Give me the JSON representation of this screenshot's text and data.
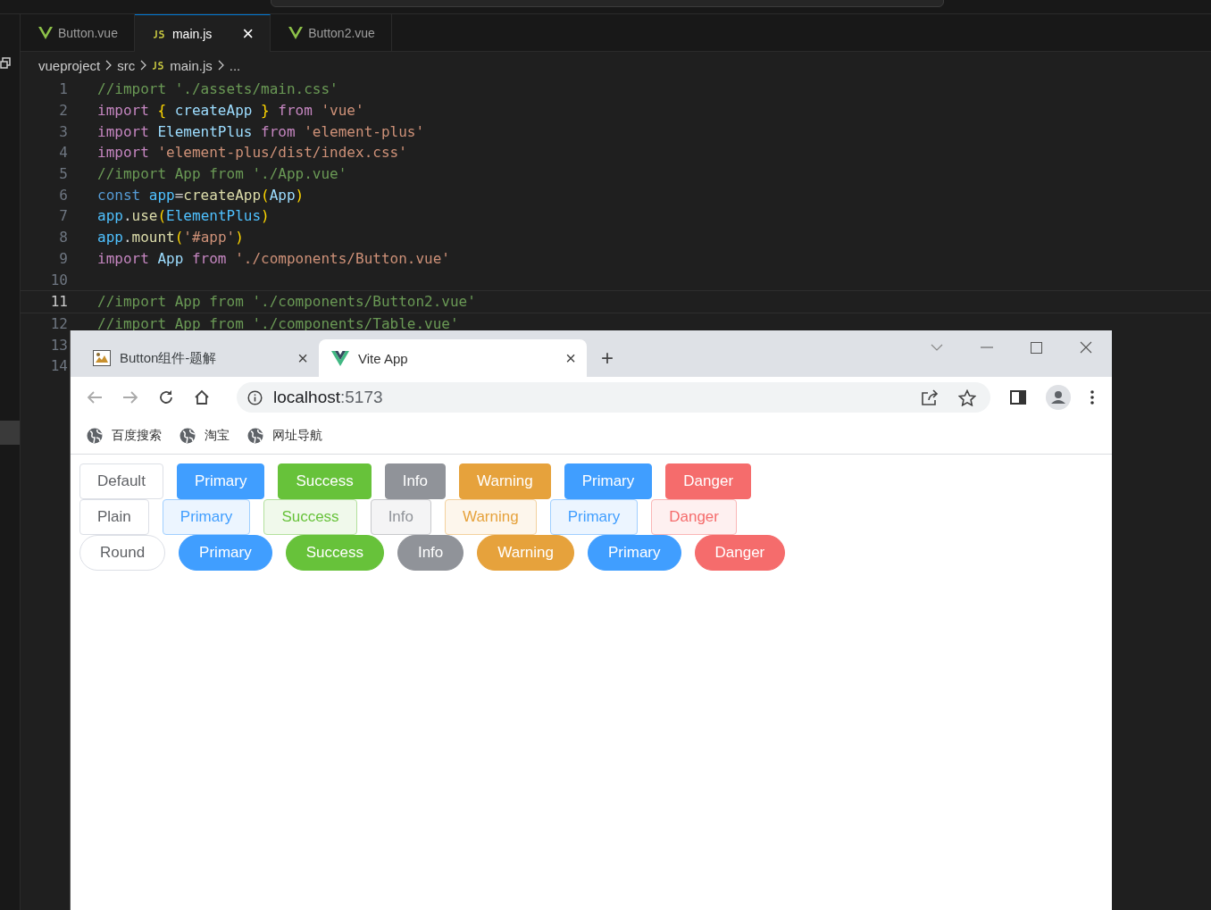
{
  "editor": {
    "tabs": [
      {
        "label": "Button.vue",
        "kind": "vue",
        "selected": false
      },
      {
        "label": "main.js",
        "kind": "js",
        "selected": true,
        "close": "×"
      },
      {
        "label": "Button2.vue",
        "kind": "vue",
        "selected": false
      }
    ],
    "breadcrumbs": [
      {
        "label": "vueproject",
        "kind": "folder"
      },
      {
        "label": "src",
        "kind": "folder"
      },
      {
        "label": "main.js",
        "kind": "js"
      },
      {
        "label": "...",
        "kind": "more"
      }
    ],
    "lines": [
      {
        "number": "1",
        "current": false,
        "tokens": [
          {
            "text": "//import './assets/main.css'",
            "kind": "comment"
          }
        ]
      },
      {
        "number": "2",
        "current": false,
        "tokens": [
          {
            "text": "import ",
            "kind": "keyword"
          },
          {
            "text": "{ ",
            "kind": "brace"
          },
          {
            "text": "createApp ",
            "kind": "variable"
          },
          {
            "text": "} ",
            "kind": "brace"
          },
          {
            "text": "from ",
            "kind": "keyword"
          },
          {
            "text": "'vue'",
            "kind": "string"
          }
        ]
      },
      {
        "number": "3",
        "current": false,
        "tokens": [
          {
            "text": "import ",
            "kind": "keyword"
          },
          {
            "text": "ElementPlus ",
            "kind": "variable"
          },
          {
            "text": "from ",
            "kind": "keyword"
          },
          {
            "text": "'element-plus'",
            "kind": "string"
          }
        ]
      },
      {
        "number": "4",
        "current": false,
        "tokens": [
          {
            "text": "import ",
            "kind": "keyword"
          },
          {
            "text": "'element-plus/dist/index.css'",
            "kind": "string"
          }
        ]
      },
      {
        "number": "5",
        "current": false,
        "tokens": [
          {
            "text": "//import App from './App.vue'",
            "kind": "comment"
          }
        ]
      },
      {
        "number": "6",
        "current": false,
        "tokens": [
          {
            "text": "const ",
            "kind": "storage"
          },
          {
            "text": "app",
            "kind": "constant"
          },
          {
            "text": "=",
            "kind": "plain"
          },
          {
            "text": "createApp",
            "kind": "function"
          },
          {
            "text": "(",
            "kind": "brace"
          },
          {
            "text": "App",
            "kind": "variable"
          },
          {
            "text": ")",
            "kind": "brace"
          }
        ]
      },
      {
        "number": "7",
        "current": false,
        "tokens": [
          {
            "text": "app",
            "kind": "constant"
          },
          {
            "text": ".",
            "kind": "plain"
          },
          {
            "text": "use",
            "kind": "function"
          },
          {
            "text": "(",
            "kind": "brace"
          },
          {
            "text": "ElementPlus",
            "kind": "constant"
          },
          {
            "text": ")",
            "kind": "brace"
          }
        ]
      },
      {
        "number": "8",
        "current": false,
        "tokens": [
          {
            "text": "app",
            "kind": "constant"
          },
          {
            "text": ".",
            "kind": "plain"
          },
          {
            "text": "mount",
            "kind": "function"
          },
          {
            "text": "(",
            "kind": "brace"
          },
          {
            "text": "'#app'",
            "kind": "string"
          },
          {
            "text": ")",
            "kind": "brace"
          }
        ]
      },
      {
        "number": "9",
        "current": false,
        "tokens": [
          {
            "text": "import ",
            "kind": "keyword"
          },
          {
            "text": "App ",
            "kind": "variable"
          },
          {
            "text": "from ",
            "kind": "keyword"
          },
          {
            "text": "'./components/Button.vue'",
            "kind": "string"
          }
        ]
      },
      {
        "number": "10",
        "current": false
      },
      {
        "number": "11",
        "current": true,
        "tokens": [
          {
            "text": "//import App from './components/Button2.vue'",
            "kind": "comment"
          }
        ]
      },
      {
        "number": "12",
        "current": false,
        "tokens": [
          {
            "text": "//import App from './components/Table.vue'",
            "kind": "comment"
          }
        ]
      },
      {
        "number": "13",
        "current": false
      },
      {
        "number": "14",
        "current": false
      }
    ]
  },
  "browser": {
    "tabs": [
      {
        "title": "Button组件-题解",
        "kind": "image",
        "selected": false,
        "close": "×"
      },
      {
        "title": "Vite App",
        "kind": "vue",
        "selected": true,
        "close": "×"
      }
    ],
    "new_tab": "+",
    "address": {
      "host": "localhost",
      "port": ":5173"
    },
    "bookmarks": [
      "百度搜索",
      "淘宝",
      "网址导航"
    ],
    "button_rows": [
      {
        "kind": "solid",
        "buttons": [
          {
            "label": "Default",
            "kind": "default"
          },
          {
            "label": "Primary",
            "kind": "primary"
          },
          {
            "label": "Success",
            "kind": "success"
          },
          {
            "label": "Info",
            "kind": "info"
          },
          {
            "label": "Warning",
            "kind": "warning"
          },
          {
            "label": "Primary",
            "kind": "primary"
          },
          {
            "label": "Danger",
            "kind": "danger"
          }
        ]
      },
      {
        "kind": "plain",
        "buttons": [
          {
            "label": "Plain",
            "kind": "default"
          },
          {
            "label": "Primary",
            "kind": "primary"
          },
          {
            "label": "Success",
            "kind": "success"
          },
          {
            "label": "Info",
            "kind": "info"
          },
          {
            "label": "Warning",
            "kind": "warning"
          },
          {
            "label": "Primary",
            "kind": "primary"
          },
          {
            "label": "Danger",
            "kind": "danger"
          }
        ]
      },
      {
        "kind": "round",
        "buttons": [
          {
            "label": "Round",
            "kind": "default"
          },
          {
            "label": "Primary",
            "kind": "primary"
          },
          {
            "label": "Success",
            "kind": "success"
          },
          {
            "label": "Info",
            "kind": "info"
          },
          {
            "label": "Warning",
            "kind": "warning"
          },
          {
            "label": "Primary",
            "kind": "primary"
          },
          {
            "label": "Danger",
            "kind": "danger"
          }
        ]
      }
    ]
  }
}
